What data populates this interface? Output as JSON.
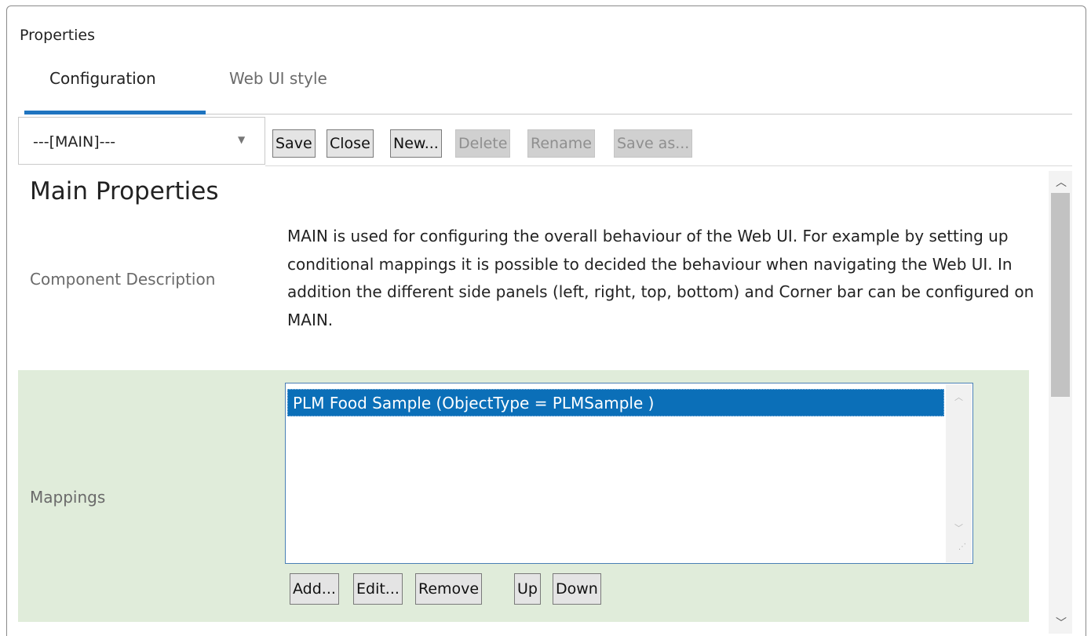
{
  "panel": {
    "title": "Properties"
  },
  "tabs": [
    {
      "label": "Configuration",
      "active": true
    },
    {
      "label": "Web UI style",
      "active": false
    }
  ],
  "toolbar": {
    "select_value": "---[MAIN]---",
    "buttons": [
      {
        "label": "Save",
        "enabled": true
      },
      {
        "label": "Close",
        "enabled": true
      },
      {
        "label": "New...",
        "enabled": true
      },
      {
        "label": "Delete",
        "enabled": false
      },
      {
        "label": "Rename",
        "enabled": false
      },
      {
        "label": "Save as...",
        "enabled": false
      }
    ]
  },
  "main": {
    "heading": "Main Properties",
    "component_description_label": "Component Description",
    "component_description": "MAIN is used for configuring the overall behaviour of the Web UI. For example by setting up conditional mappings it is possible to decided the behaviour when navigating the Web UI. In addition the different side panels (left, right, top, bottom) and Corner bar can be configured on MAIN.",
    "mappings_label": "Mappings",
    "mappings": [
      "PLM Food Sample (ObjectType = PLMSample )"
    ],
    "selected_mapping_index": 0,
    "mapping_buttons": {
      "add": "Add...",
      "edit": "Edit...",
      "remove": "Remove",
      "up": "Up",
      "down": "Down"
    }
  },
  "colors": {
    "accent": "#1f74c0",
    "selection": "#0b6fb8",
    "mapping_section_bg": "#e0ecda"
  },
  "icons": {
    "select_caret": "chevron-down-icon",
    "scroll_up": "chevron-up-icon",
    "scroll_down": "chevron-down-icon",
    "resize_grip": "resize-grip-icon"
  }
}
